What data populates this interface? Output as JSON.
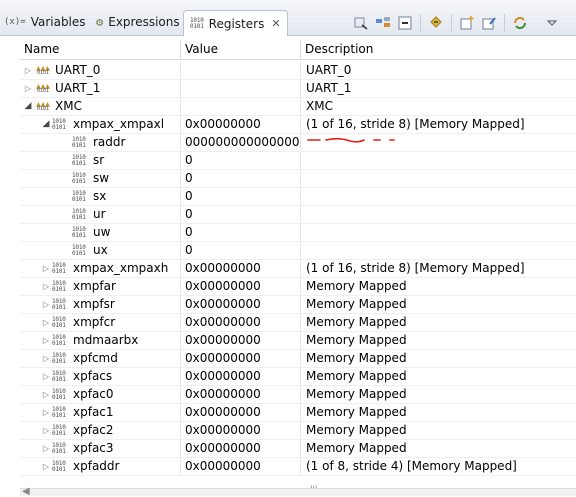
{
  "tabs": [
    {
      "prefix": "(x)=",
      "label": "Variables"
    },
    {
      "prefix": "⚙",
      "label": "Expressions"
    },
    {
      "prefix": "",
      "label": "Registers",
      "close": "✕"
    }
  ],
  "toolbar_icons": [
    "select-all-icon",
    "layout-icon",
    "collapse-all-icon",
    "refresh-registers-icon",
    "new-group-icon",
    "edit-group-icon",
    "sync-icon",
    "view-menu-icon"
  ],
  "columns": {
    "name": "Name",
    "value": "Value",
    "description": "Description"
  },
  "rows": [
    {
      "name": "UART_0",
      "value": "",
      "desc": "UART_0"
    },
    {
      "name": "UART_1",
      "value": "",
      "desc": "UART_1"
    },
    {
      "name": "XMC",
      "value": "",
      "desc": "XMC"
    },
    {
      "name": "xmpax_xmpaxl",
      "value": "0x00000000",
      "desc": "(1 of 16, stride 8) [Memory Mapped]"
    },
    {
      "name": "raddr",
      "value": "00000000000000000...",
      "desc": ""
    },
    {
      "name": "sr",
      "value": "0",
      "desc": ""
    },
    {
      "name": "sw",
      "value": "0",
      "desc": ""
    },
    {
      "name": "sx",
      "value": "0",
      "desc": ""
    },
    {
      "name": "ur",
      "value": "0",
      "desc": ""
    },
    {
      "name": "uw",
      "value": "0",
      "desc": ""
    },
    {
      "name": "ux",
      "value": "0",
      "desc": ""
    },
    {
      "name": "xmpax_xmpaxh",
      "value": "0x00000000",
      "desc": "(1 of 16, stride 8) [Memory Mapped]"
    },
    {
      "name": "xmpfar",
      "value": "0x00000000",
      "desc": "Memory Mapped"
    },
    {
      "name": "xmpfsr",
      "value": "0x00000000",
      "desc": "Memory Mapped"
    },
    {
      "name": "xmpfcr",
      "value": "0x00000000",
      "desc": "Memory Mapped"
    },
    {
      "name": "mdmaarbx",
      "value": "0x00000000",
      "desc": "Memory Mapped"
    },
    {
      "name": "xpfcmd",
      "value": "0x00000000",
      "desc": "Memory Mapped"
    },
    {
      "name": "xpfacs",
      "value": "0x00000000",
      "desc": "Memory Mapped"
    },
    {
      "name": "xpfac0",
      "value": "0x00000000",
      "desc": "Memory Mapped"
    },
    {
      "name": "xpfac1",
      "value": "0x00000000",
      "desc": "Memory Mapped"
    },
    {
      "name": "xpfac2",
      "value": "0x00000000",
      "desc": "Memory Mapped"
    },
    {
      "name": "xpfac3",
      "value": "0x00000000",
      "desc": "Memory Mapped"
    },
    {
      "name": "xpfaddr",
      "value": "0x00000000",
      "desc": "(1 of 8, stride 4) [Memory Mapped]"
    }
  ],
  "binary_icon_text": [
    "1010",
    "0101"
  ],
  "colors": {
    "annotation": "#e0201a",
    "group_icon": "#c08a2a",
    "header_border": "#b9c3d0"
  },
  "scrollbar": {
    "grip": "'''"
  }
}
